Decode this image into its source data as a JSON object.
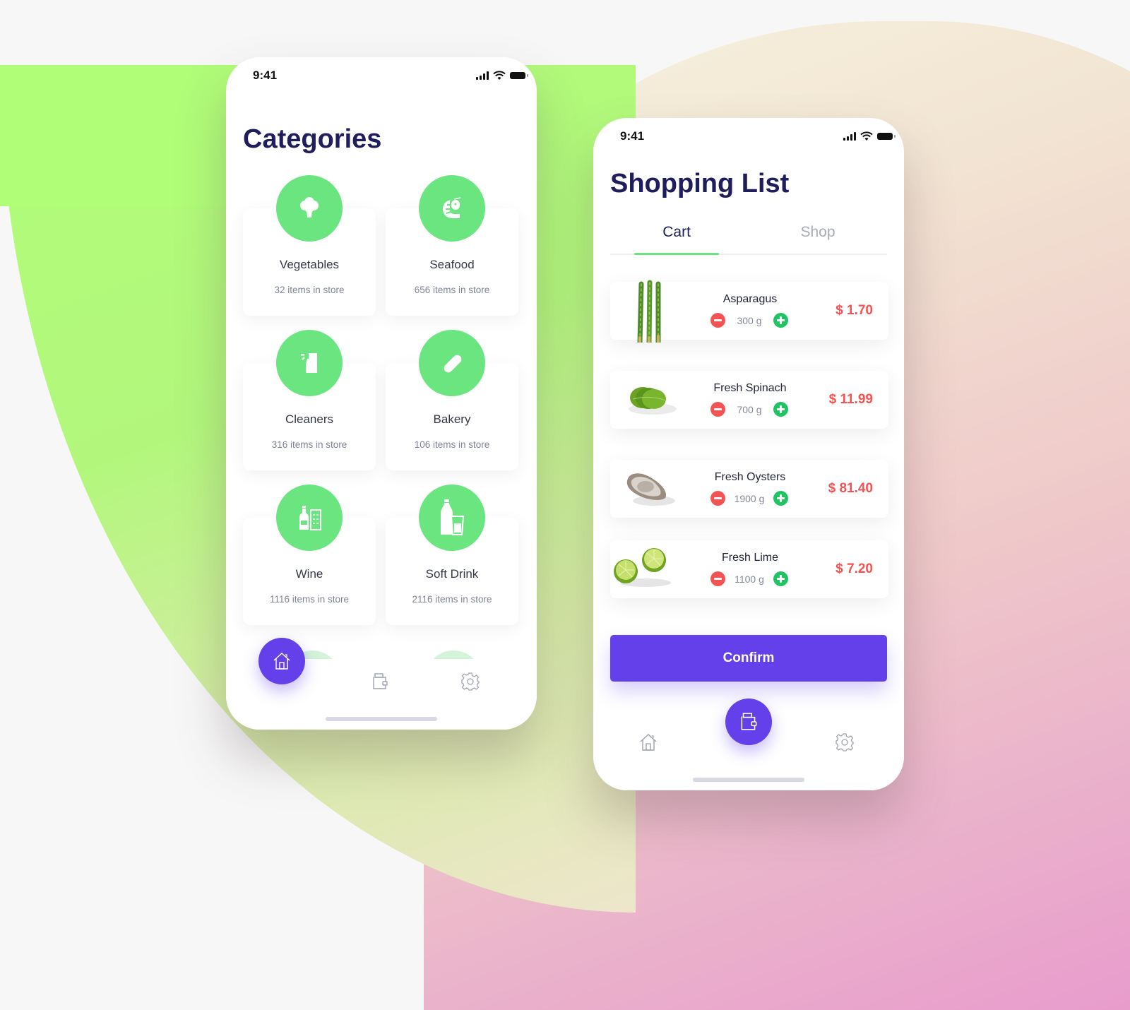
{
  "status_bar": {
    "time": "9:41"
  },
  "categories_screen": {
    "title": "Categories",
    "categories": [
      {
        "name": "Vegetables",
        "count": "32 items in store",
        "icon": "broccoli-icon"
      },
      {
        "name": "Seafood",
        "count": "656 items in store",
        "icon": "shrimp-icon"
      },
      {
        "name": "Cleaners",
        "count": "316 items in store",
        "icon": "spray-bottle-icon"
      },
      {
        "name": "Bakery",
        "count": "106 items in store",
        "icon": "bread-icon"
      },
      {
        "name": "Wine",
        "count": "1116 items in store",
        "icon": "wine-bottle-icon"
      },
      {
        "name": "Soft Drink",
        "count": "2116 items in store",
        "icon": "soda-bottle-icon"
      }
    ],
    "nav": {
      "active": "home",
      "items": [
        "home-icon",
        "wallet-icon",
        "settings-icon"
      ]
    }
  },
  "shopping_screen": {
    "title": "Shopping List",
    "tabs": [
      {
        "label": "Cart",
        "active": true
      },
      {
        "label": "Shop",
        "active": false
      }
    ],
    "items": [
      {
        "name": "Asparagus",
        "quantity": "300 g",
        "price": "$ 1.70",
        "image": "asparagus"
      },
      {
        "name": "Fresh Spinach",
        "quantity": "700 g",
        "price": "$ 11.99",
        "image": "spinach"
      },
      {
        "name": "Fresh Oysters",
        "quantity": "1900 g",
        "price": "$ 81.40",
        "image": "oyster"
      },
      {
        "name": "Fresh Lime",
        "quantity": "1100 g",
        "price": "$ 7.20",
        "image": "lime"
      }
    ],
    "confirm_label": "Confirm",
    "nav": {
      "active": "wallet",
      "items": [
        "home-icon",
        "wallet-icon",
        "settings-icon"
      ]
    }
  },
  "colors": {
    "accent": "#6340ea",
    "category_green": "#6ae57f",
    "price_red": "#f35353",
    "plus_green": "#20c462",
    "title_navy": "#1f1d5c"
  }
}
